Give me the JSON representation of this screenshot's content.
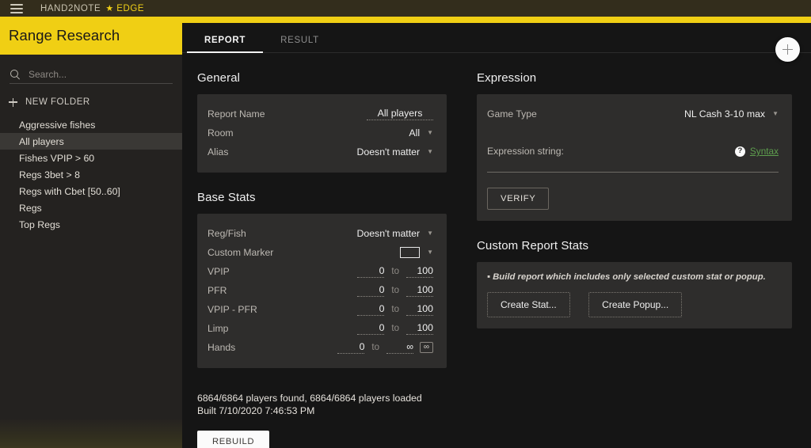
{
  "topbar": {
    "menu_icon": "hamburger-icon",
    "brand": "HAND2NOTE",
    "star": "★",
    "edition": "EDGE"
  },
  "sidebar": {
    "title": "Range Research",
    "add_button": "+",
    "search": {
      "value": "",
      "placeholder": "Search..."
    },
    "new_folder_label": "NEW FOLDER",
    "items": [
      {
        "label": "Aggressive fishes",
        "selected": false
      },
      {
        "label": "All players",
        "selected": true
      },
      {
        "label": "Fishes VPIP > 60",
        "selected": false
      },
      {
        "label": "Regs 3bet > 8",
        "selected": false
      },
      {
        "label": "Regs with Cbet [50..60]",
        "selected": false
      },
      {
        "label": "Regs",
        "selected": false
      },
      {
        "label": "Top Regs",
        "selected": false
      }
    ]
  },
  "tabs": [
    {
      "label": "REPORT",
      "active": true
    },
    {
      "label": "RESULT",
      "active": false
    }
  ],
  "general": {
    "title": "General",
    "report_name_label": "Report Name",
    "report_name_value": "All players",
    "room_label": "Room",
    "room_value": "All",
    "alias_label": "Alias",
    "alias_value": "Doesn't matter"
  },
  "base_stats": {
    "title": "Base Stats",
    "reg_fish_label": "Reg/Fish",
    "reg_fish_value": "Doesn't matter",
    "custom_marker_label": "Custom Marker",
    "custom_marker_color": "#2e2d2c",
    "to_label": "to",
    "ranges": [
      {
        "label": "VPIP",
        "min": "0",
        "max": "100",
        "infinity": false
      },
      {
        "label": "PFR",
        "min": "0",
        "max": "100",
        "infinity": false
      },
      {
        "label": "VPIP - PFR",
        "min": "0",
        "max": "100",
        "infinity": false
      },
      {
        "label": "Limp",
        "min": "0",
        "max": "100",
        "infinity": false
      },
      {
        "label": "Hands",
        "min": "0",
        "max": "∞",
        "infinity": true
      }
    ],
    "infinity_button": "∞"
  },
  "expression": {
    "title": "Expression",
    "game_type_label": "Game Type",
    "game_type_value": "NL Cash 3-10 max",
    "expression_string_label": "Expression string:",
    "expression_string_value": "",
    "help_icon": "?",
    "syntax_link": "Syntax",
    "syntax_link_color": "#5e9e4e",
    "verify_button": "VERIFY"
  },
  "custom_report_stats": {
    "title": "Custom Report Stats",
    "note": "▪ Build report which includes only selected custom stat or popup.",
    "create_stat_button": "Create Stat...",
    "create_popup_button": "Create Popup..."
  },
  "footer": {
    "status_line1": "6864/6864 players found, 6864/6864 players loaded",
    "status_line2": "Built 7/10/2020 7:46:53 PM",
    "rebuild_button": "REBUILD"
  },
  "theme": {
    "accent_yellow": "#f0cf14",
    "topbar_bg": "#332d1c",
    "sidebar_bg": "#242220",
    "content_bg": "#151515",
    "card_bg": "#2e2d2c"
  }
}
